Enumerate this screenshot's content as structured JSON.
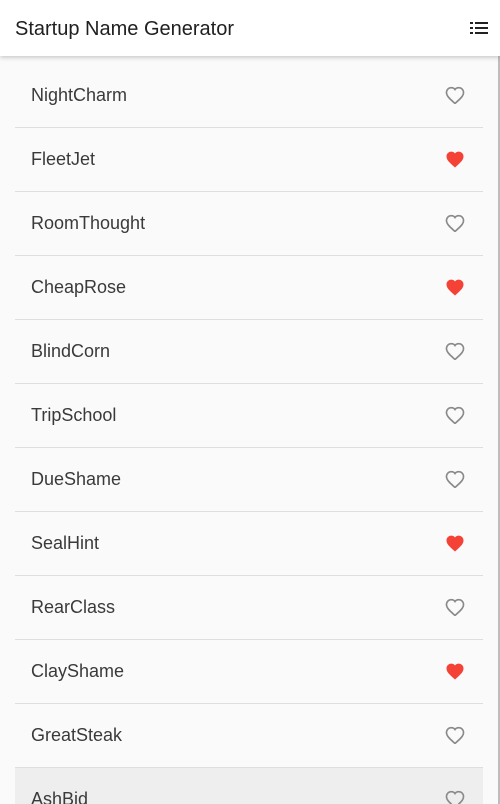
{
  "app": {
    "title": "Startup Name Generator",
    "menu_icon": "list-icon"
  },
  "colors": {
    "favorite": "#f44336",
    "unfavorited": "#8a8a8a",
    "divider": "#dedede",
    "background": "#fafafa"
  },
  "items": [
    {
      "name": "NightCharm",
      "favorite": false
    },
    {
      "name": "FleetJet",
      "favorite": true
    },
    {
      "name": "RoomThought",
      "favorite": false
    },
    {
      "name": "CheapRose",
      "favorite": true
    },
    {
      "name": "BlindCorn",
      "favorite": false
    },
    {
      "name": "TripSchool",
      "favorite": false
    },
    {
      "name": "DueShame",
      "favorite": false
    },
    {
      "name": "SealHint",
      "favorite": true
    },
    {
      "name": "RearClass",
      "favorite": false
    },
    {
      "name": "ClayShame",
      "favorite": true
    },
    {
      "name": "GreatSteak",
      "favorite": false
    },
    {
      "name": "AshBid",
      "favorite": false,
      "highlighted": true
    }
  ]
}
